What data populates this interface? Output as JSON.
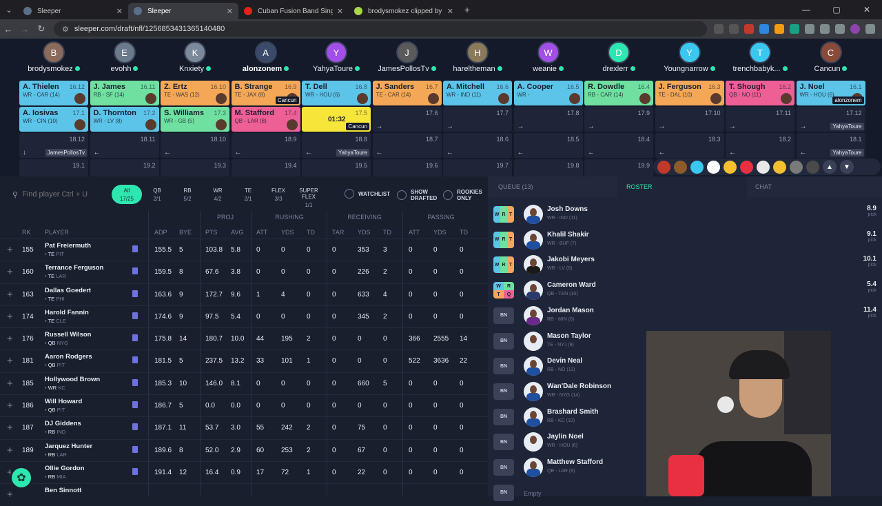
{
  "browser": {
    "tabs": [
      {
        "title": "Sleeper",
        "active": false,
        "favicon": "sleeper-icon",
        "color": "#5b6f8a"
      },
      {
        "title": "Sleeper",
        "active": true,
        "favicon": "sleeper-icon",
        "color": "#5b6f8a"
      },
      {
        "title": "Cuban Fusion Band Sings 'I Wa...",
        "active": false,
        "favicon": "youtube-icon",
        "color": "#e62117"
      },
      {
        "title": "brodysmokez clipped by Gayle...",
        "active": false,
        "favicon": "twitch-clip-icon",
        "color": "#a8d84a"
      }
    ],
    "url": "sleeper.com/draft/nfl/1256853431365140480"
  },
  "board": {
    "drafters": [
      {
        "name": "brodysmokez",
        "initial": "B",
        "color": "#8a6a5a"
      },
      {
        "name": "evohh",
        "initial": "E",
        "color": "#6a7a8a"
      },
      {
        "name": "Knxiety",
        "initial": "K",
        "color": "#7a8a9a"
      },
      {
        "name": "alonzonem",
        "initial": "A",
        "color": "#3a4a6a",
        "user": true
      },
      {
        "name": "YahyaToure",
        "initial": "Y",
        "color": "#a24ee8"
      },
      {
        "name": "JamesPollosTv",
        "initial": "J",
        "color": "#5a5a5a"
      },
      {
        "name": "hareltheman",
        "initial": "H",
        "color": "#8a7a5a"
      },
      {
        "name": "weanie",
        "initial": "W",
        "color": "#a24ee8"
      },
      {
        "name": "drexlerr",
        "initial": "D",
        "color": "#2ee6b0"
      },
      {
        "name": "Youngnarrow",
        "initial": "Y",
        "color": "#3ac8f0"
      },
      {
        "name": "trenchbabyk...",
        "initial": "T",
        "color": "#3ac8f0"
      },
      {
        "name": "Cancun",
        "initial": "C",
        "color": "#8a4a3a"
      }
    ],
    "round16": [
      {
        "name": "A. Thielen",
        "pick": "16.12",
        "info": "WR - CAR (14)",
        "pos": "wr"
      },
      {
        "name": "J. James",
        "pick": "16.11",
        "info": "RB - SF (14)",
        "pos": "rb"
      },
      {
        "name": "Z. Ertz",
        "pick": "16.10",
        "info": "TE - WAS (12)",
        "pos": "te"
      },
      {
        "name": "B. Strange",
        "pick": "16.9",
        "info": "TE - JAX (8)",
        "pos": "te",
        "owner": "Cancun"
      },
      {
        "name": "T. Dell",
        "pick": "16.8",
        "info": "WR - HOU (6)",
        "pos": "wr"
      },
      {
        "name": "J. Sanders",
        "pick": "16.7",
        "info": "TE - CAR (14)",
        "pos": "te"
      },
      {
        "name": "A. Mitchell",
        "pick": "16.6",
        "info": "WR - IND (11)",
        "pos": "wr"
      },
      {
        "name": "A. Cooper",
        "pick": "16.5",
        "info": "WR -",
        "pos": "wr"
      },
      {
        "name": "R. Dowdle",
        "pick": "16.4",
        "info": "RB - CAR (14)",
        "pos": "rb"
      },
      {
        "name": "J. Ferguson",
        "pick": "16.3",
        "info": "TE - DAL (10)",
        "pos": "te"
      },
      {
        "name": "T. Shough",
        "pick": "16.2",
        "info": "QB - NO (11)",
        "pos": "qb"
      },
      {
        "name": "J. Noel",
        "pick": "16.1",
        "info": "WR - HOU (6)",
        "pos": "wr",
        "owner": "alonzonem"
      }
    ],
    "round17": [
      {
        "name": "A. Iosivas",
        "pick": "17.1",
        "info": "WR - CIN (10)",
        "pos": "wr"
      },
      {
        "name": "D. Thornton",
        "pick": "17.2",
        "info": "WR - LV (8)",
        "pos": "wr"
      },
      {
        "name": "S. Williams",
        "pick": "17.3",
        "info": "WR - GB (5)",
        "pos": "rb"
      },
      {
        "name": "M. Stafford",
        "pick": "17.4",
        "info": "QB - LAR (8)",
        "pos": "qb"
      },
      {
        "name": "",
        "pick": "17.5",
        "info": "",
        "pos": "clock",
        "timer": "01:32",
        "owner": "Cancun"
      },
      {
        "name": "",
        "pick": "17.6",
        "pos": "empty"
      },
      {
        "name": "",
        "pick": "17.7",
        "pos": "empty"
      },
      {
        "name": "",
        "pick": "17.8",
        "pos": "empty"
      },
      {
        "name": "",
        "pick": "17.9",
        "pos": "empty"
      },
      {
        "name": "",
        "pick": "17.10",
        "pos": "empty"
      },
      {
        "name": "",
        "pick": "17.11",
        "pos": "empty"
      },
      {
        "name": "",
        "pick": "17.12",
        "pos": "empty",
        "owner": "YahyaToure"
      }
    ],
    "round18": [
      {
        "pick": "18.12",
        "pos": "empty",
        "owner": "JamesPollosTv",
        "arrow": "↓"
      },
      {
        "pick": "18.11",
        "pos": "empty",
        "arrow": "←"
      },
      {
        "pick": "18.10",
        "pos": "empty",
        "arrow": "←"
      },
      {
        "pick": "18.9",
        "pos": "empty",
        "arrow": "←"
      },
      {
        "pick": "18.8",
        "pos": "empty",
        "arrow": "←",
        "owner": "YahyaToure"
      },
      {
        "pick": "18.7",
        "pos": "empty",
        "arrow": "←"
      },
      {
        "pick": "18.6",
        "pos": "empty",
        "arrow": "←"
      },
      {
        "pick": "18.5",
        "pos": "empty",
        "arrow": "←"
      },
      {
        "pick": "18.4",
        "pos": "empty",
        "arrow": "←"
      },
      {
        "pick": "18.3",
        "pos": "empty",
        "arrow": "←"
      },
      {
        "pick": "18.2",
        "pos": "empty",
        "arrow": "←"
      },
      {
        "pick": "18.1",
        "pos": "empty",
        "arrow": "←",
        "owner": "YahyaToure"
      }
    ],
    "round19": [
      "19.1",
      "19.2",
      "19.3",
      "19.4",
      "19.5",
      "19.6",
      "19.7",
      "19.8",
      "19.9"
    ],
    "emoji_colors": [
      "#c0392b",
      "#8e5a2a",
      "#3ac8f0",
      "#ffffff",
      "#f4c030",
      "#e83040",
      "#e8e8e8",
      "#f4c030",
      "#7a7a7a",
      "#4a4a4a"
    ]
  },
  "search": {
    "placeholder": "Find player Ctrl + U"
  },
  "filters": [
    {
      "label": "All",
      "count": "17/25",
      "active": true
    },
    {
      "label": "QB",
      "count": "2/1"
    },
    {
      "label": "RB",
      "count": "5/2"
    },
    {
      "label": "WR",
      "count": "4/2"
    },
    {
      "label": "TE",
      "count": "2/1"
    },
    {
      "label": "FLEX",
      "count": "3/3"
    },
    {
      "label": "SUPER FLEX",
      "count": "1/1"
    }
  ],
  "toggles": {
    "watchlist": "WATCHLIST",
    "show_drafted_1": "SHOW",
    "show_drafted_2": "DRAFTED",
    "rookies_1": "ROOKIES",
    "rookies_2": "ONLY"
  },
  "columns": {
    "rk": "RK",
    "player": "PLAYER",
    "adp": "ADP",
    "bye": "BYE",
    "proj": "PROJ",
    "rushing": "RUSHING",
    "receiving": "RECEIVING",
    "passing": "PASSING",
    "pts": "PTS",
    "avg": "AVG",
    "att": "ATT",
    "yds": "YDS",
    "td": "TD",
    "tar": "TAR"
  },
  "players": [
    {
      "rk": "155",
      "name": "Pat Freiermuth",
      "pos": "TE",
      "team": "PIT",
      "adp": "155.5",
      "bye": "5",
      "pts": "103.8",
      "avg": "5.8",
      "ratt": "0",
      "ryds": "0",
      "rtd": "0",
      "tar": "0",
      "cyds": "353",
      "ctd": "3",
      "patt": "0",
      "pyds": "0",
      "ptd": "0"
    },
    {
      "rk": "160",
      "name": "Terrance Ferguson",
      "pos": "TE",
      "team": "LAR",
      "adp": "159.5",
      "bye": "8",
      "pts": "67.6",
      "avg": "3.8",
      "ratt": "0",
      "ryds": "0",
      "rtd": "0",
      "tar": "0",
      "cyds": "226",
      "ctd": "2",
      "patt": "0",
      "pyds": "0",
      "ptd": "0"
    },
    {
      "rk": "163",
      "name": "Dallas Goedert",
      "pos": "TE",
      "team": "PHI",
      "adp": "163.6",
      "bye": "9",
      "pts": "172.7",
      "avg": "9.6",
      "ratt": "1",
      "ryds": "4",
      "rtd": "0",
      "tar": "0",
      "cyds": "633",
      "ctd": "4",
      "patt": "0",
      "pyds": "0",
      "ptd": "0"
    },
    {
      "rk": "174",
      "name": "Harold Fannin",
      "pos": "TE",
      "team": "CLE",
      "adp": "174.6",
      "bye": "9",
      "pts": "97.5",
      "avg": "5.4",
      "ratt": "0",
      "ryds": "0",
      "rtd": "0",
      "tar": "0",
      "cyds": "345",
      "ctd": "2",
      "patt": "0",
      "pyds": "0",
      "ptd": "0"
    },
    {
      "rk": "176",
      "name": "Russell Wilson",
      "pos": "QB",
      "team": "NYG",
      "adp": "175.8",
      "bye": "14",
      "pts": "180.7",
      "avg": "10.0",
      "ratt": "44",
      "ryds": "195",
      "rtd": "2",
      "tar": "0",
      "cyds": "0",
      "ctd": "0",
      "patt": "366",
      "pyds": "2555",
      "ptd": "14"
    },
    {
      "rk": "181",
      "name": "Aaron Rodgers",
      "pos": "QB",
      "team": "PIT",
      "adp": "181.5",
      "bye": "5",
      "pts": "237.5",
      "avg": "13.2",
      "ratt": "33",
      "ryds": "101",
      "rtd": "1",
      "tar": "0",
      "cyds": "0",
      "ctd": "0",
      "patt": "522",
      "pyds": "3636",
      "ptd": "22"
    },
    {
      "rk": "185",
      "name": "Hollywood Brown",
      "pos": "WR",
      "team": "KC",
      "adp": "185.3",
      "bye": "10",
      "pts": "146.0",
      "avg": "8.1",
      "ratt": "0",
      "ryds": "0",
      "rtd": "0",
      "tar": "0",
      "cyds": "660",
      "ctd": "5",
      "patt": "0",
      "pyds": "0",
      "ptd": "0"
    },
    {
      "rk": "186",
      "name": "Will Howard",
      "pos": "QB",
      "team": "PIT",
      "adp": "186.7",
      "bye": "5",
      "pts": "0.0",
      "avg": "0.0",
      "ratt": "0",
      "ryds": "0",
      "rtd": "0",
      "tar": "0",
      "cyds": "0",
      "ctd": "0",
      "patt": "0",
      "pyds": "0",
      "ptd": "0"
    },
    {
      "rk": "187",
      "name": "DJ Giddens",
      "pos": "RB",
      "team": "IND",
      "adp": "187.1",
      "bye": "11",
      "pts": "53.7",
      "avg": "3.0",
      "ratt": "55",
      "ryds": "242",
      "rtd": "2",
      "tar": "0",
      "cyds": "75",
      "ctd": "0",
      "patt": "0",
      "pyds": "0",
      "ptd": "0"
    },
    {
      "rk": "189",
      "name": "Jarquez Hunter",
      "pos": "RB",
      "team": "LAR",
      "adp": "189.6",
      "bye": "8",
      "pts": "52.0",
      "avg": "2.9",
      "ratt": "60",
      "ryds": "253",
      "rtd": "2",
      "tar": "0",
      "cyds": "67",
      "ctd": "0",
      "patt": "0",
      "pyds": "0",
      "ptd": "0"
    },
    {
      "rk": "",
      "name": "Ollie Gordon",
      "pos": "RB",
      "team": "MIA",
      "adp": "191.4",
      "bye": "12",
      "pts": "16.4",
      "avg": "0.9",
      "ratt": "17",
      "ryds": "72",
      "rtd": "1",
      "tar": "0",
      "cyds": "22",
      "ctd": "0",
      "patt": "0",
      "pyds": "0",
      "ptd": "0"
    },
    {
      "rk": "",
      "name": "Ben Sinnott",
      "pos": "",
      "team": "",
      "adp": "",
      "bye": "",
      "pts": "",
      "avg": "",
      "ratt": "",
      "ryds": "",
      "rtd": "",
      "tar": "",
      "cyds": "",
      "ctd": "",
      "patt": "",
      "pyds": "",
      "ptd": ""
    }
  ],
  "panel": {
    "tabs": {
      "queue": "QUEUE (13)",
      "roster": "ROSTER",
      "chat": "CHAT"
    },
    "roster": [
      {
        "badge": "WRT",
        "name": "Josh Downs",
        "info": "WR - IND (11)",
        "pick": "8.9",
        "pick_label": "pick",
        "jersey": "#1f4fa0"
      },
      {
        "badge": "WRT",
        "name": "Khalil Shakir",
        "info": "WR - BUF (7)",
        "pick": "9.1",
        "pick_label": "pick",
        "jersey": "#1f4fa0"
      },
      {
        "badge": "WRT",
        "name": "Jakobi Meyers",
        "info": "WR - LV (8)",
        "pick": "10.1",
        "pick_label": "pick",
        "jersey": "#1a1a1a"
      },
      {
        "badge": "SF",
        "name": "Cameron Ward",
        "info": "QB - TEN (10)",
        "pick": "5.4",
        "pick_label": "pick",
        "jersey": "#2a3a6a"
      },
      {
        "badge": "BN",
        "name": "Jordan Mason",
        "info": "RB - MIN (6)",
        "pick": "11.4",
        "pick_label": "pick",
        "jersey": "#6a2a8a"
      },
      {
        "badge": "BN",
        "name": "Mason Taylor",
        "info": "TE - NYJ (9)",
        "pick": "",
        "pick_label": "",
        "jersey": "#e8ecf3"
      },
      {
        "badge": "BN",
        "name": "Devin Neal",
        "info": "RB - NO (11)",
        "pick": "",
        "pick_label": "",
        "jersey": "#1f4fa0"
      },
      {
        "badge": "BN",
        "name": "Wan'Dale Robinson",
        "info": "WR - NYG (14)",
        "pick": "",
        "pick_label": "",
        "jersey": "#1f4fa0"
      },
      {
        "badge": "BN",
        "name": "Brashard Smith",
        "info": "RB - KC (10)",
        "pick": "",
        "pick_label": "",
        "jersey": "#1f4fa0"
      },
      {
        "badge": "BN",
        "name": "Jaylin Noel",
        "info": "WR - HOU (6)",
        "pick": "",
        "pick_label": "",
        "jersey": "#e8ecf3"
      },
      {
        "badge": "BN",
        "name": "Matthew Stafford",
        "info": "QB - LAR (8)",
        "pick": "",
        "pick_label": "",
        "jersey": "#1f4fa0"
      },
      {
        "badge": "BN",
        "name": "",
        "info": "",
        "pick": "",
        "pick_label": "",
        "empty": "Empty"
      }
    ]
  },
  "colors": {
    "accent": "#2ee6b0",
    "wr": "#5cc4e8",
    "rb": "#6fe0a0",
    "te": "#f4a857",
    "qb": "#ee5f96",
    "clock": "#f7e63a"
  }
}
